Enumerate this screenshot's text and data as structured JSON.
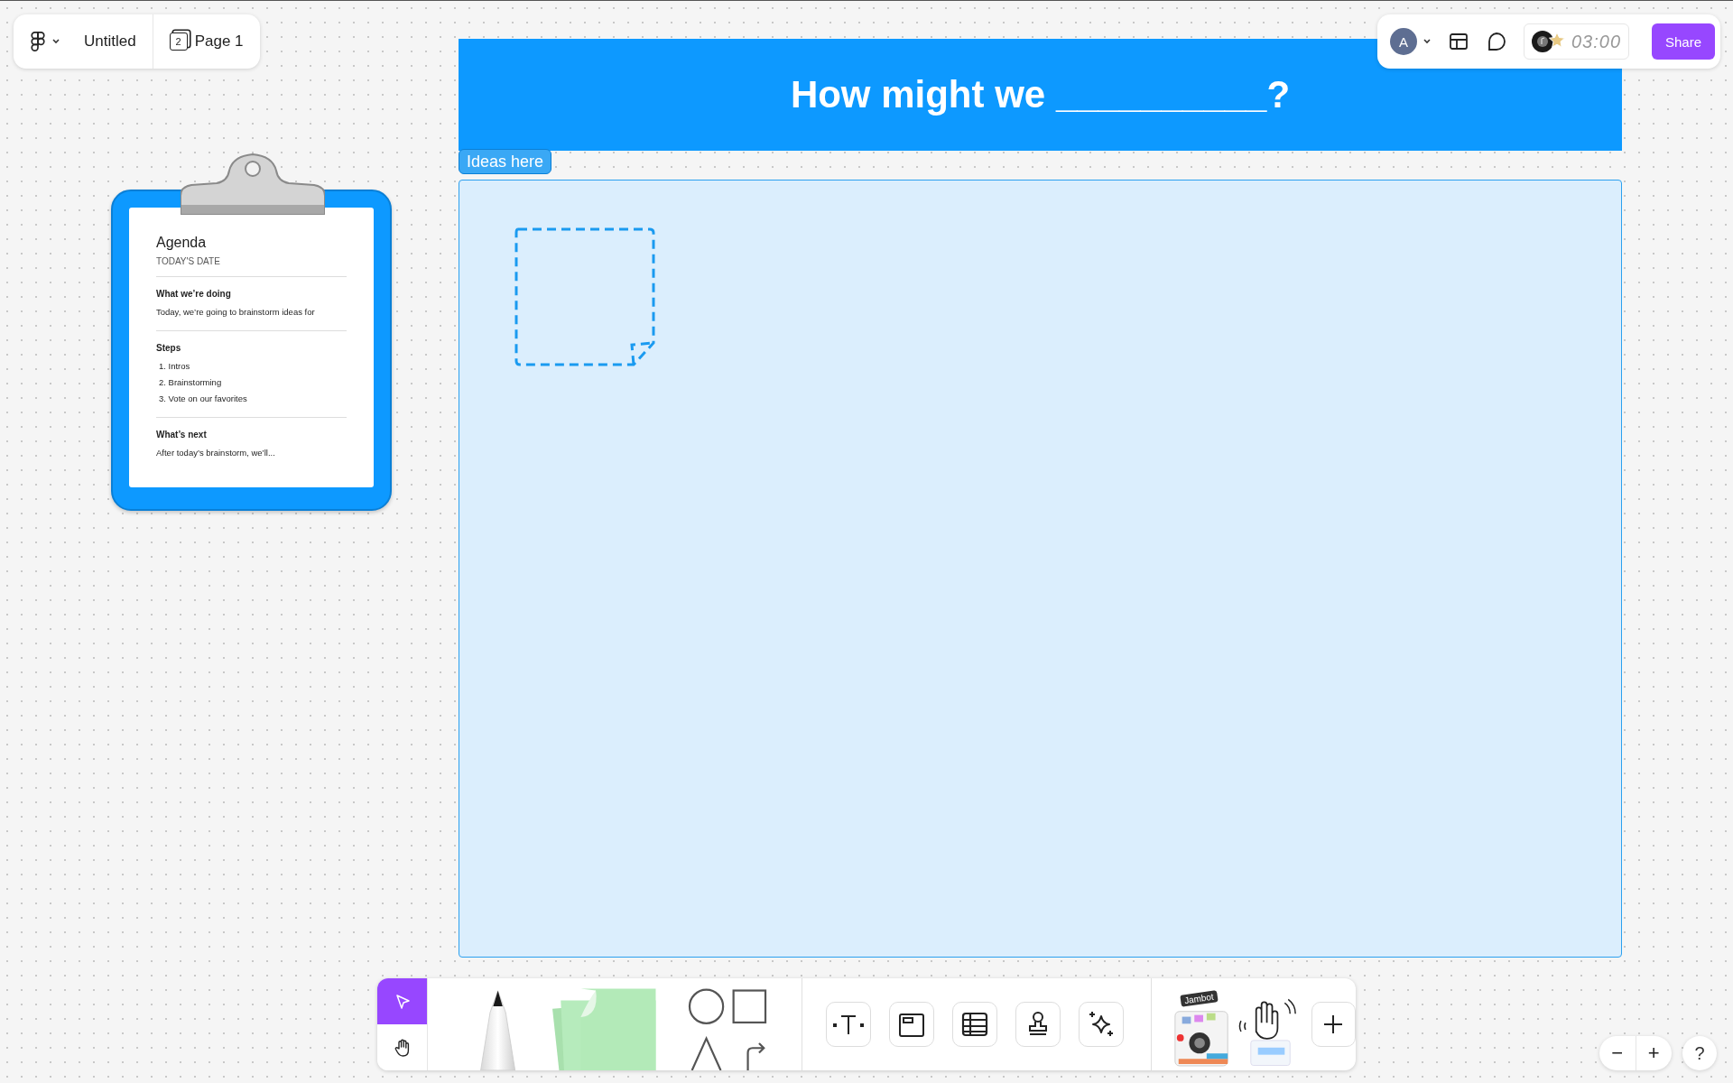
{
  "file_menu": {
    "file_name": "Untitled",
    "page_number": "2",
    "page_name": "Page 1"
  },
  "top_right": {
    "avatar_initial": "A",
    "timer": "03:00",
    "share_label": "Share"
  },
  "canvas": {
    "banner_title": "How might we __________?",
    "section_label": "Ideas here",
    "agenda": {
      "title": "Agenda",
      "date": "TODAY'S DATE",
      "sections": [
        {
          "heading": "What we’re doing",
          "lines": [
            "Today, we’re going to brainstorm ideas for"
          ]
        },
        {
          "heading": "Steps",
          "lines": [
            "1. Intros",
            "2. Brainstorming",
            "3. Vote on our favorites"
          ]
        },
        {
          "heading": "What’s next",
          "lines": [
            "After today’s brainstorm, we’ll..."
          ]
        }
      ]
    }
  },
  "toolbar": {
    "modes": [
      {
        "kind": "select",
        "selected": true
      },
      {
        "kind": "hand",
        "selected": false
      }
    ],
    "widget_label": "Jambot"
  },
  "zoom": {
    "minus": "−",
    "plus": "+"
  },
  "help": "?"
}
